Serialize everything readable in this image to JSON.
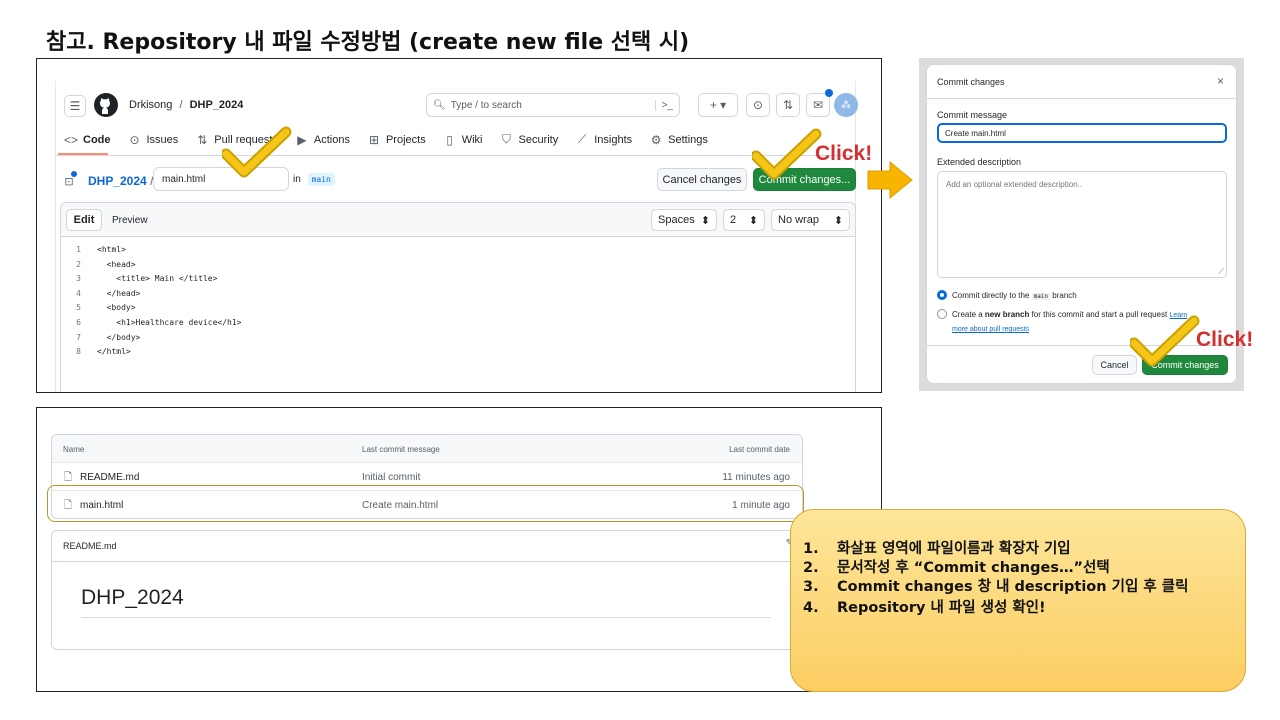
{
  "slide_title": "참고. Repository 내 파일 수정방법 (create new file 선택 시)",
  "editor": {
    "owner": "Drkisong",
    "repo": "DHP_2024",
    "search_placeholder": "Type / to search",
    "tabs": [
      "Code",
      "Issues",
      "Pull requests",
      "Actions",
      "Projects",
      "Wiki",
      "Security",
      "Insights",
      "Settings"
    ],
    "breadcrumb_repo": "DHP_2024",
    "filename": "main.html",
    "in_label": "in",
    "branch": "main",
    "cancel_label": "Cancel changes",
    "commit_label": "Commit changes...",
    "edit_tab": "Edit",
    "preview_tab": "Preview",
    "indent_mode": "Spaces",
    "indent_size": "2",
    "wrap_mode": "No wrap",
    "code_lines": [
      {
        "n": "1",
        "text": "<html>"
      },
      {
        "n": "2",
        "text": "  <head>"
      },
      {
        "n": "3",
        "text": "    <title> Main </title>"
      },
      {
        "n": "4",
        "text": "  </head>"
      },
      {
        "n": "5",
        "text": "  <body>"
      },
      {
        "n": "6",
        "text": "    <h1>Healthcare device</h1>"
      },
      {
        "n": "7",
        "text": "  </body>"
      },
      {
        "n": "8",
        "text": "</html>"
      }
    ]
  },
  "click_label": "Click!",
  "dialog": {
    "title": "Commit changes",
    "message_label": "Commit message",
    "message_value": "Create main.html",
    "desc_label": "Extended description",
    "desc_placeholder": "Add an optional extended description..",
    "radio1_pre": "Commit directly to the ",
    "radio1_branch": "main",
    "radio1_post": " branch",
    "radio2_pre": "Create a ",
    "radio2_bold": "new branch",
    "radio2_post": " for this commit and start a pull request ",
    "radio2_link1": "Learn",
    "radio2_link2": "more about pull requests",
    "cancel": "Cancel",
    "commit": "Commit changes"
  },
  "file_list": {
    "headers": {
      "name": "Name",
      "message": "Last commit message",
      "date": "Last commit date"
    },
    "rows": [
      {
        "name": "README.md",
        "message": "Initial commit",
        "date": "11 minutes ago"
      },
      {
        "name": "main.html",
        "message": "Create main.html",
        "date": "1 minute ago"
      }
    ],
    "readme_label": "README.md",
    "readme_heading": "DHP_2024"
  },
  "notes": [
    {
      "num": "1.",
      "text": "화살표 영역에 파일이름과 확장자 기입"
    },
    {
      "num": "2.",
      "text": "문서작성 후 “Commit changes…”선택"
    },
    {
      "num": "3.",
      "text": "Commit changes 창 내 description 기입 후 클릭"
    },
    {
      "num": "4.",
      "text": "Repository 내 파일 생성 확인!"
    }
  ],
  "colors": {
    "green": "#1f883d",
    "click_red": "#d32f2f",
    "check_yellow": "#f5c518",
    "arrow_orange": "#f7b500",
    "note_bg": "#fdd77a"
  }
}
